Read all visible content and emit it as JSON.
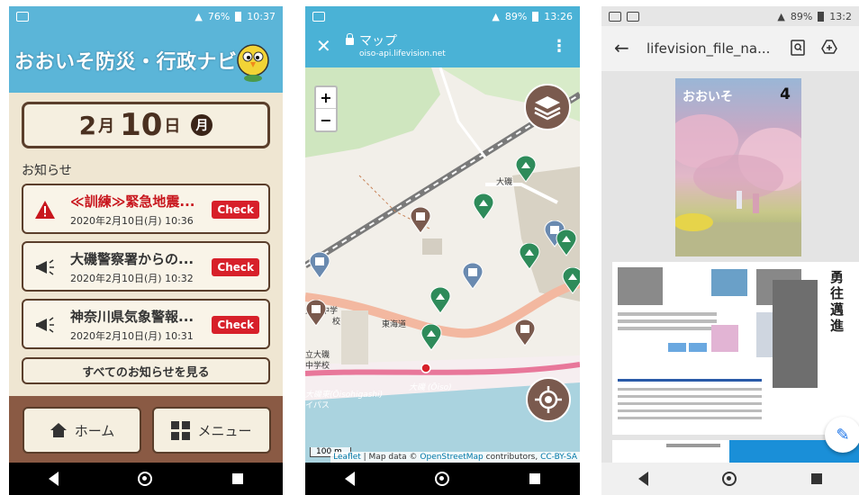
{
  "phone1": {
    "status": {
      "battery": "76%",
      "time": "10:37",
      "network": "4G"
    },
    "app_title": "おおいそ防災・行政ナビ",
    "date": {
      "month": "2",
      "month_unit": "月",
      "day": "10",
      "day_unit": "日",
      "weekday": "月"
    },
    "notices_heading": "お知らせ",
    "notices": [
      {
        "title": "≪訓練≫緊急地震...",
        "date": "2020年2月10日(月) 10:36",
        "icon": "warning-icon",
        "check": "Check"
      },
      {
        "title": "大磯警察署からの...",
        "date": "2020年2月10日(月) 10:32",
        "icon": "megaphone-icon",
        "check": "Check"
      },
      {
        "title": "神奈川県気象警報...",
        "date": "2020年2月10日(月) 10:31",
        "icon": "megaphone-icon",
        "check": "Check"
      }
    ],
    "all_notices_label": "すべてのお知らせを見る",
    "home_label": "ホーム",
    "menu_label": "メニュー"
  },
  "phone2": {
    "status": {
      "battery": "89%",
      "time": "13:26",
      "network": "4G"
    },
    "title": "マップ",
    "url": "oiso-api.lifevision.net",
    "zoom_in": "+",
    "zoom_out": "−",
    "labels": {
      "oiso_station": "大磯",
      "oiso_jhs": "大磯中学",
      "school": "校",
      "tokaido": "東海道",
      "school_left": "立大磯",
      "school_left2": "中学校",
      "oiso_higashi": "大磯東(Ōisohigashi)",
      "bypass": "イパス",
      "oiso_road": "大磯 (Ōiso)"
    },
    "scale": "100 m",
    "attribution_prefix": "Leaflet",
    "attribution_mid": " | Map data © ",
    "attribution_osm": "OpenStreetMap",
    "attribution_suffix": " contributors, ",
    "attribution_cc": "CC-BY-SA"
  },
  "phone3": {
    "status": {
      "battery": "89%",
      "time": "13:2",
      "network": "4G"
    },
    "file_title": "lifevision_file_na...",
    "cover_title": "おおいそ",
    "cover_number": "4",
    "article_title": "勇往邁進"
  }
}
